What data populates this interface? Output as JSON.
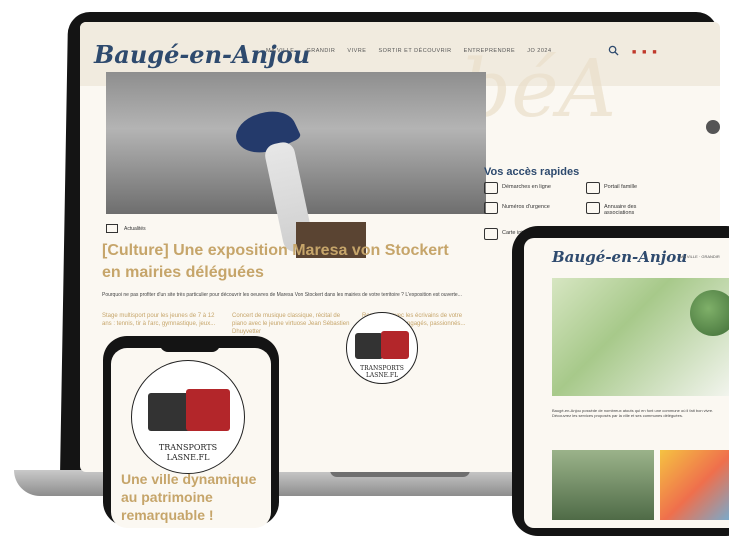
{
  "laptop": {
    "logo": "Baugé-en-Anjou",
    "nav": [
      "MA VILLE",
      "GRANDIR",
      "VIVRE",
      "SORTIR ET DÉCOUVRIR",
      "ENTREPRENDRE",
      "JO 2024"
    ],
    "tag": "Actualités",
    "article_title": "[Culture] Une exposition Maresa von Stockert en mairies déléguées",
    "excerpt": "Pourquoi ne pas profiter d'un site très particulier pour découvrir les oeuvres de Maresa Von Stockert dans les mairies de votre territoire ? L'exposition est ouverte...",
    "links": [
      "Stage multisport pour les jeunes de 7 à 12 ans : tennis, tir à l'arc, gymnastique, jeux...",
      "Concert de musique classique, récital de piano avec le jeune virtuose Jean Sébastien Dhuyvetter",
      "Rencontre avec les écrivains de votre région, auteurs engagés, passionnés..."
    ],
    "quick_access_title": "Vos accès rapides",
    "quick_access": [
      "Démarches en ligne",
      "Portail famille",
      "Numéros d'urgence",
      "Annuaire des associations",
      "Carte interactive"
    ],
    "truck_text": "TRANSPORTS\nLASNE.FL"
  },
  "phone": {
    "headline": "Une ville dynamique au patrimoine remarquable !",
    "truck_text": "TRANSPORTS\nLASNE.FL"
  },
  "tablet": {
    "logo": "Baugé-en-Anjou",
    "nav": "MA VILLE · GRANDIR",
    "text": "Baugé-en-Anjou possède de nombreux atouts qui en font une commune où il fait bon vivre. Découvrez les services proposés par la ville et ses communes déléguées."
  }
}
